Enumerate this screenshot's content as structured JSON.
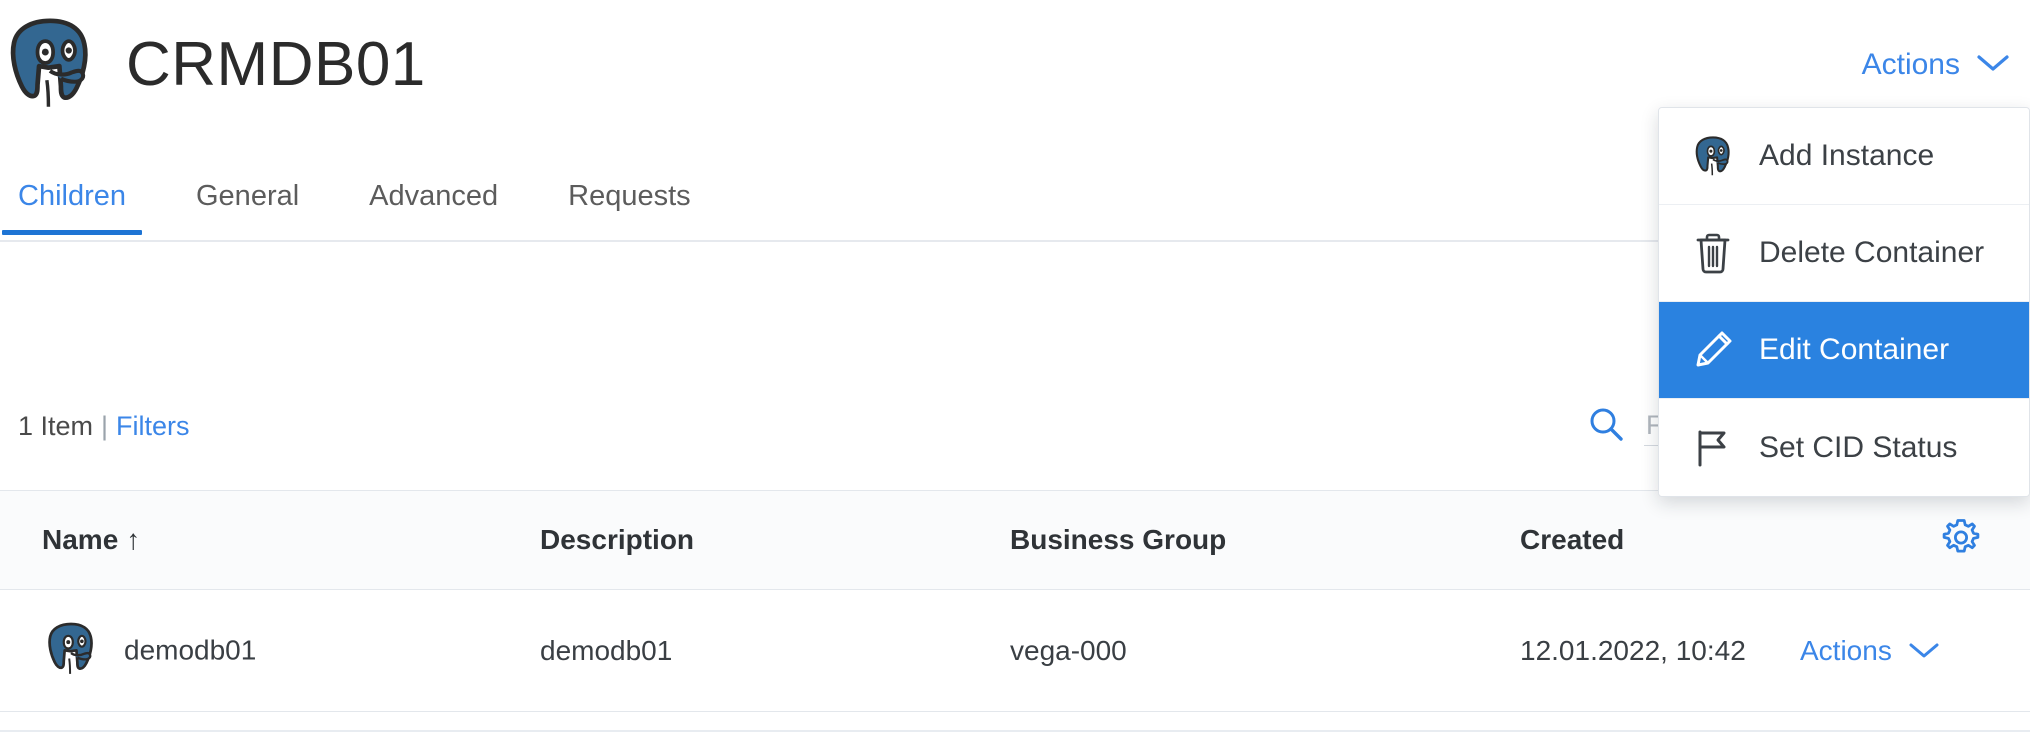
{
  "header": {
    "title": "CRMDB01",
    "logo_icon": "postgresql-elephant-icon",
    "actions_label": "Actions",
    "actions_chevron_icon": "chevron-down-icon"
  },
  "tabs": [
    {
      "label": "Children",
      "active": true
    },
    {
      "label": "General",
      "active": false
    },
    {
      "label": "Advanced",
      "active": false
    },
    {
      "label": "Requests",
      "active": false
    }
  ],
  "toolbar": {
    "item_count": "1 Item",
    "separator": "|",
    "filters_label": "Filters",
    "search_icon": "search-icon",
    "search_value": "",
    "search_placeholder": "Filter"
  },
  "actions_menu": {
    "visible": true,
    "items": [
      {
        "label": "Add Instance",
        "icon": "postgresql-elephant-icon",
        "highlighted": false
      },
      {
        "label": "Delete Container",
        "icon": "trash-icon",
        "highlighted": false
      },
      {
        "label": "Edit Container",
        "icon": "pencil-icon",
        "highlighted": true
      },
      {
        "label": "Set CID Status",
        "icon": "flag-icon",
        "highlighted": false
      }
    ]
  },
  "table": {
    "columns": [
      {
        "label": "Name",
        "sort": "asc",
        "sort_icon": "arrow-up-icon"
      },
      {
        "label": "Description",
        "sort": null
      },
      {
        "label": "Business Group",
        "sort": null
      },
      {
        "label": "Created",
        "sort": null
      }
    ],
    "settings_icon": "gear-icon",
    "rows": [
      {
        "icon": "postgresql-elephant-icon",
        "name": "demodb01",
        "description": "demodb01",
        "business_group": "vega-000",
        "created": "12.01.2022, 10:42",
        "actions_label": "Actions",
        "actions_chevron_icon": "chevron-down-icon"
      }
    ]
  },
  "colors": {
    "accent_blue": "#3b86e8",
    "highlight_blue": "#2a82e0",
    "tab_underline": "#1e74d4",
    "postgres_blue": "#336791",
    "text_dark": "#2b2b2b",
    "border_gray": "#e3e7ec",
    "header_bg": "#fafbfc"
  }
}
